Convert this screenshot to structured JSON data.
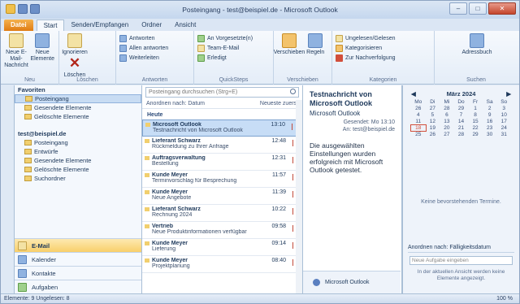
{
  "window": {
    "title": "Posteingang - test@beispiel.de - Microsoft Outlook"
  },
  "tabs": [
    "Datei",
    "Start",
    "Senden/Empfangen",
    "Ordner",
    "Ansicht"
  ],
  "ribbon": {
    "groups": [
      {
        "label": "Neu",
        "big": [
          "Neue E-Mail-Nachricht",
          "Neue Elemente"
        ]
      },
      {
        "label": "Löschen",
        "big": [
          "Ignorieren",
          "Löschen"
        ]
      },
      {
        "label": "Antworten",
        "small": [
          "Antworten",
          "Allen antworten",
          "Weiterleiten"
        ]
      },
      {
        "label": "QuickSteps",
        "small": [
          "An Vorgesetzte(n)",
          "Team-E-Mail",
          "Erledigt"
        ]
      },
      {
        "label": "Verschieben",
        "big": [
          "Verschieben",
          "Regeln"
        ]
      },
      {
        "label": "Kategorien",
        "small": [
          "Ungelesen/Gelesen",
          "Kategorisieren",
          "Zur Nachverfolgung"
        ]
      },
      {
        "label": "Suchen",
        "big": [
          "Adressbuch"
        ]
      }
    ]
  },
  "nav": {
    "favorites": "Favoriten",
    "fav_items": [
      "Posteingang",
      "Gesendete Elemente",
      "Gelöschte Elemente"
    ],
    "account": "test@beispiel.de",
    "acc_items": [
      "Posteingang",
      "Entwürfe",
      "Gesendete Elemente",
      "Gelöschte Elemente",
      "Suchordner"
    ],
    "buttons": [
      "E-Mail",
      "Kalender",
      "Kontakte",
      "Aufgaben"
    ]
  },
  "list": {
    "search_placeholder": "Posteingang durchsuchen (Strg+E)",
    "arrange": "Anordnen nach: Datum",
    "order": "Neueste zuerst",
    "group": "Heute",
    "messages": [
      {
        "from": "Microsoft Outlook",
        "date": "13:10",
        "subj": "Testnachricht von Microsoft Outlook"
      },
      {
        "from": "Lieferant Schwarz",
        "date": "12:48",
        "subj": "Rückmeldung zu Ihrer Anfrage"
      },
      {
        "from": "Auftragsverwaltung",
        "date": "12:31",
        "subj": "Bestellung"
      },
      {
        "from": "Kunde Meyer",
        "date": "11:57",
        "subj": "Terminvorschlag für Besprechung"
      },
      {
        "from": "Kunde Meyer",
        "date": "11:39",
        "subj": "Neue Angebote"
      },
      {
        "from": "Lieferant Schwarz",
        "date": "10:22",
        "subj": "Rechnung 2024"
      },
      {
        "from": "Vertrieb",
        "date": "09:58",
        "subj": "Neue Produktinformationen verfügbar"
      },
      {
        "from": "Kunde Meyer",
        "date": "09:14",
        "subj": "Lieferung"
      },
      {
        "from": "Kunde Meyer",
        "date": "08:40",
        "subj": "Projektplanung"
      }
    ]
  },
  "reading": {
    "title": "Testnachricht von Microsoft Outlook",
    "sender": "Microsoft Outlook",
    "sent": "Gesendet: Mo 13:10",
    "to": "An: test@beispiel.de",
    "body": "Die ausgewählten Einstellungen wurden erfolgreich mit Microsoft Outlook getestet.",
    "footer": "Microsoft Outlook"
  },
  "todo": {
    "month": "März 2024",
    "weekdays": [
      "Mo",
      "Di",
      "Mi",
      "Do",
      "Fr",
      "Sa",
      "So"
    ],
    "days": [
      "26",
      "27",
      "28",
      "29",
      "1",
      "2",
      "3",
      "4",
      "5",
      "6",
      "7",
      "8",
      "9",
      "10",
      "11",
      "12",
      "13",
      "14",
      "15",
      "16",
      "17",
      "18",
      "19",
      "20",
      "21",
      "22",
      "23",
      "24",
      "25",
      "26",
      "27",
      "28",
      "29",
      "30",
      "31"
    ],
    "today": "18",
    "no_appt": "Keine bevorstehenden Termine.",
    "task_header": "Anordnen nach: Fälligkeitsdatum",
    "task_input": "Neue Aufgabe eingeben",
    "task_note": "In der aktuellen Ansicht werden keine Elemente angezeigt."
  },
  "status": {
    "left": "Elemente: 9    Ungelesen: 8",
    "zoom": "100 %"
  }
}
